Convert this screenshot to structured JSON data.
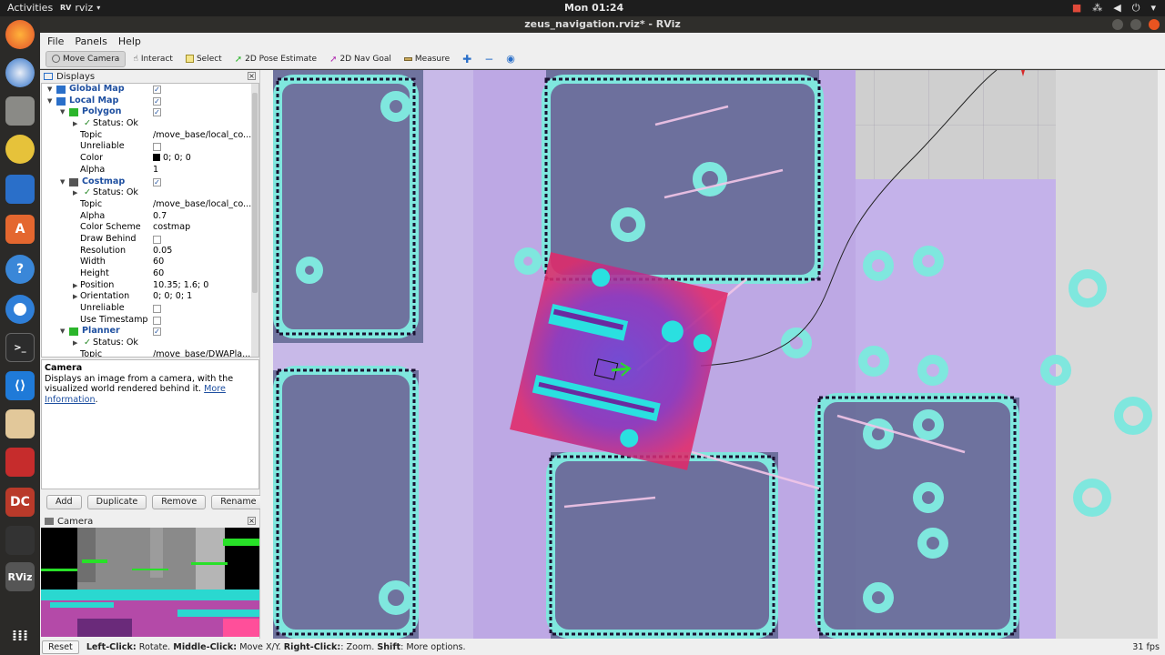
{
  "topbar": {
    "activities": "Activities",
    "app_name": "rviz",
    "clock": "Mon 01:24"
  },
  "window": {
    "title": "zeus_navigation.rviz* - RViz"
  },
  "menu": [
    "File",
    "Panels",
    "Help"
  ],
  "toolbar": {
    "move_camera": "Move Camera",
    "interact": "Interact",
    "select": "Select",
    "pose_estimate": "2D Pose Estimate",
    "nav_goal": "2D Nav Goal",
    "measure": "Measure"
  },
  "displays_panel": {
    "title": "Displays",
    "rows": [
      {
        "name": "Global Map",
        "type": "display",
        "checked": true
      },
      {
        "name": "Local Map",
        "type": "display",
        "checked": true
      },
      {
        "name": "Polygon",
        "type": "display",
        "checked": true
      },
      {
        "name": "Status: Ok",
        "type": "status"
      },
      {
        "name": "Topic",
        "value": "/move_base/local_co..."
      },
      {
        "name": "Unreliable",
        "type": "checkbox",
        "checked": false
      },
      {
        "name": "Color",
        "value": "0; 0; 0"
      },
      {
        "name": "Alpha",
        "value": "1"
      },
      {
        "name": "Costmap",
        "type": "display",
        "checked": true
      },
      {
        "name": "Status: Ok",
        "type": "status"
      },
      {
        "name": "Topic",
        "value": "/move_base/local_co..."
      },
      {
        "name": "Alpha",
        "value": "0.7"
      },
      {
        "name": "Color Scheme",
        "value": "costmap"
      },
      {
        "name": "Draw Behind",
        "type": "checkbox",
        "checked": false
      },
      {
        "name": "Resolution",
        "value": "0.05"
      },
      {
        "name": "Width",
        "value": "60"
      },
      {
        "name": "Height",
        "value": "60"
      },
      {
        "name": "Position",
        "value": "10.35; 1.6; 0"
      },
      {
        "name": "Orientation",
        "value": "0; 0; 0; 1"
      },
      {
        "name": "Unreliable",
        "type": "checkbox",
        "checked": false
      },
      {
        "name": "Use Timestamp",
        "type": "checkbox",
        "checked": false
      },
      {
        "name": "Planner",
        "type": "display",
        "checked": true
      },
      {
        "name": "Status: Ok",
        "type": "status"
      },
      {
        "name": "Topic",
        "value": "/move_base/DWAPla..."
      }
    ]
  },
  "help": {
    "title": "Camera",
    "text": "Displays an image from a camera, with the visualized world rendered behind it.",
    "link": "More Information"
  },
  "buttons": {
    "add": "Add",
    "duplicate": "Duplicate",
    "remove": "Remove",
    "rename": "Rename"
  },
  "camera_panel": {
    "title": "Camera"
  },
  "statusbar": {
    "reset": "Reset",
    "hint_left_bold": "Left-Click:",
    "hint_left": " Rotate. ",
    "hint_middle_bold": "Middle-Click:",
    "hint_middle": " Move X/Y. ",
    "hint_right_bold": "Right-Click:",
    "hint_right": ": Zoom. ",
    "hint_shift_bold": "Shift",
    "hint_shift": ": More options.",
    "fps": "31 fps"
  }
}
